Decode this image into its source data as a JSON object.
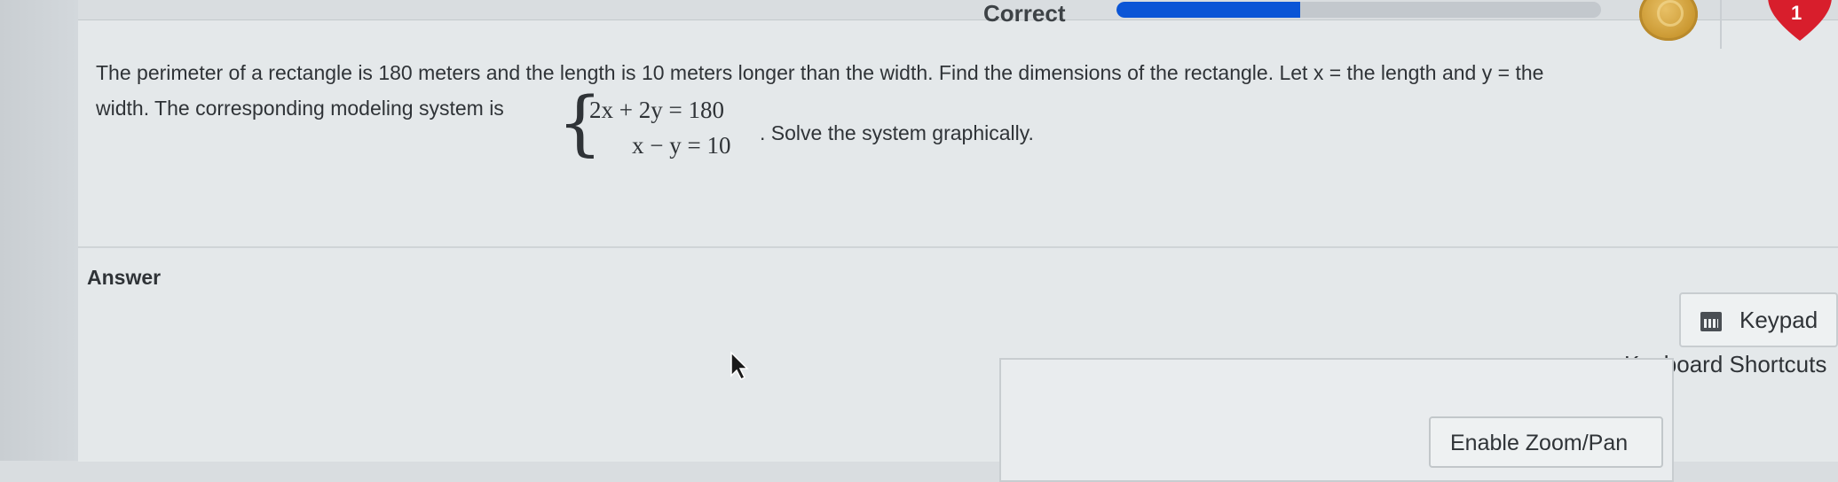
{
  "status": {
    "label": "Correct",
    "progress_percent": 38
  },
  "hearts": {
    "count": "1"
  },
  "question": {
    "line1": "The perimeter of a rectangle is 180 meters and the length is 10 meters longer than the width. Find the dimensions of the rectangle. Let x =  the length and y =  the",
    "line2_prefix": "width. The corresponding modeling system is",
    "equation1": "2x + 2y = 180",
    "equation2": "x − y = 10",
    "line2_suffix": ". Solve the system graphically."
  },
  "answer": {
    "label": "Answer",
    "keypad_label": "Keypad",
    "shortcuts_label": "Keyboard Shortcuts",
    "zoom_label": "Enable Zoom/Pan"
  },
  "colors": {
    "accent": "#0b55d6",
    "heart": "#d81e2c",
    "coin": "#c9962e"
  },
  "icons": {
    "keypad": "calculator-icon",
    "coin": "coin-icon",
    "heart": "heart-icon",
    "cursor": "mouse-cursor-icon"
  }
}
